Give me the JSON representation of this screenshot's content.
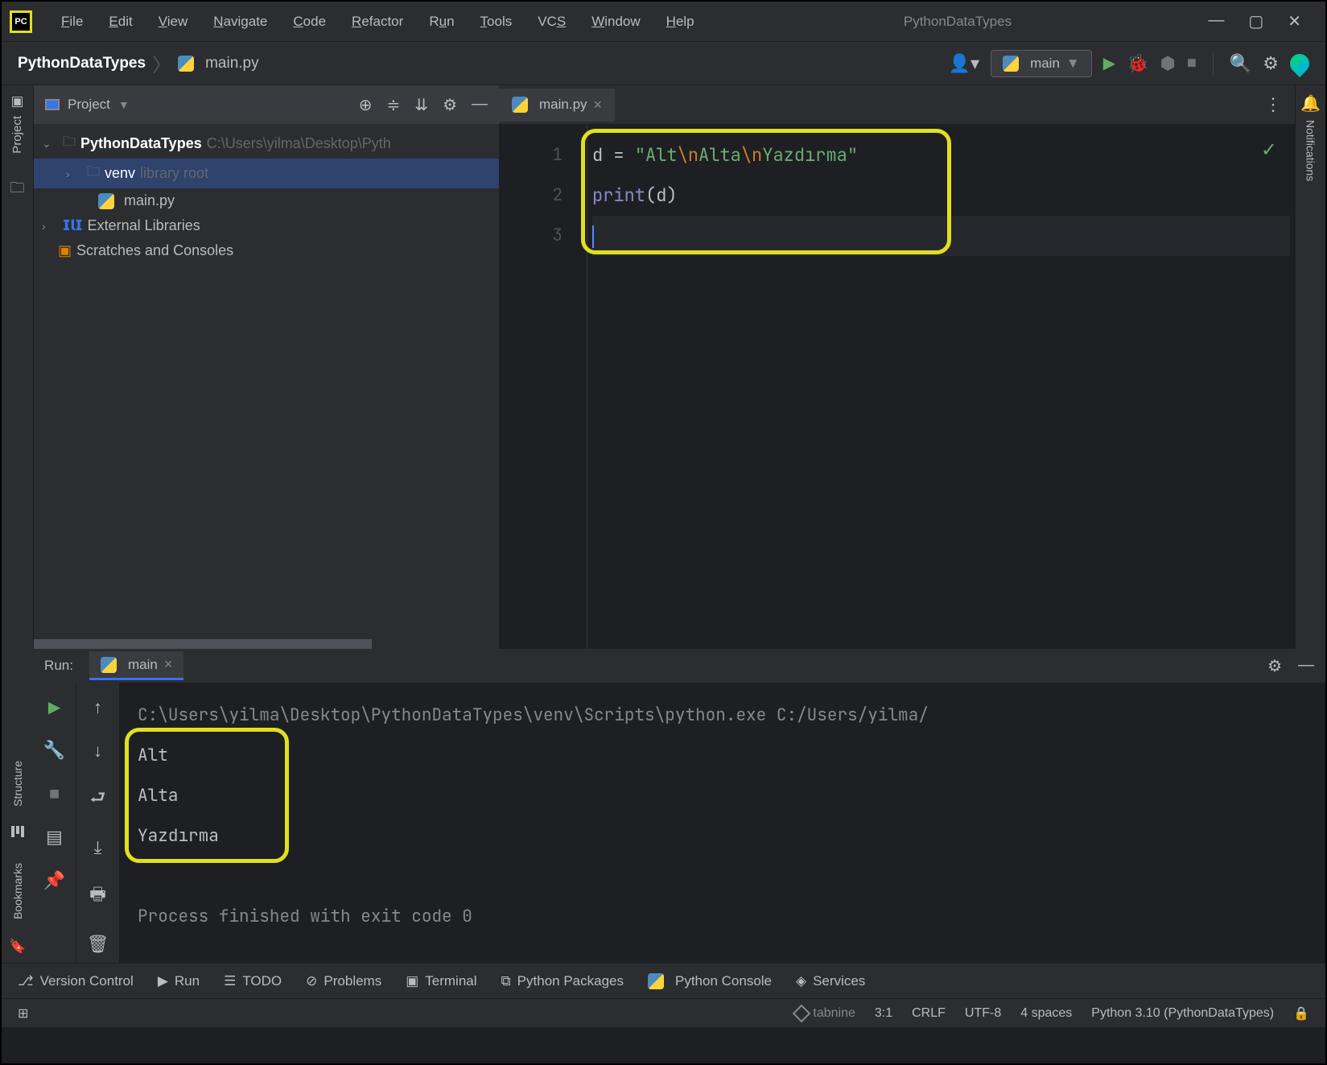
{
  "menu": {
    "file": "File",
    "edit": "Edit",
    "view": "View",
    "navigate": "Navigate",
    "code": "Code",
    "refactor": "Refactor",
    "run": "Run",
    "tools": "Tools",
    "vcs": "VCS",
    "window": "Window",
    "help": "Help"
  },
  "window_title": "PythonDataTypes",
  "breadcrumb": {
    "project": "PythonDataTypes",
    "file": "main.py"
  },
  "run_config": "main",
  "project_panel": {
    "title": "Project",
    "root": "PythonDataTypes",
    "root_path": "C:\\Users\\yilma\\Desktop\\Pyth",
    "venv": "venv",
    "venv_note": "library root",
    "file": "main.py",
    "ext_libs": "External Libraries",
    "scratches": "Scratches and Consoles"
  },
  "editor": {
    "tab": "main.py",
    "lines": [
      "1",
      "2",
      "3"
    ],
    "code": {
      "l1_var": "d",
      "l1_eq": " = ",
      "l1_q1": "\"",
      "l1_s1": "Alt",
      "l1_e1": "\\n",
      "l1_s2": "Alta",
      "l1_e2": "\\n",
      "l1_s3": "Yazdırma",
      "l1_q2": "\"",
      "l2_fn": "print",
      "l2_p1": "(",
      "l2_arg": "d",
      "l2_p2": ")"
    }
  },
  "run": {
    "label": "Run:",
    "tab": "main",
    "cmd": "C:\\Users\\yilma\\Desktop\\PythonDataTypes\\venv\\Scripts\\python.exe C:/Users/yilma/",
    "out1": "Alt",
    "out2": "Alta",
    "out3": "Yazdırma",
    "exit": "Process finished with exit code 0"
  },
  "bottom": {
    "version_control": "Version Control",
    "run": "Run",
    "todo": "TODO",
    "problems": "Problems",
    "terminal": "Terminal",
    "packages": "Python Packages",
    "console": "Python Console",
    "services": "Services"
  },
  "status": {
    "tabnine": "tabnine",
    "pos": "3:1",
    "crlf": "CRLF",
    "encoding": "UTF-8",
    "indent": "4 spaces",
    "interpreter": "Python 3.10 (PythonDataTypes)"
  },
  "rails": {
    "project": "Project",
    "structure": "Structure",
    "bookmarks": "Bookmarks",
    "notifications": "Notifications"
  }
}
